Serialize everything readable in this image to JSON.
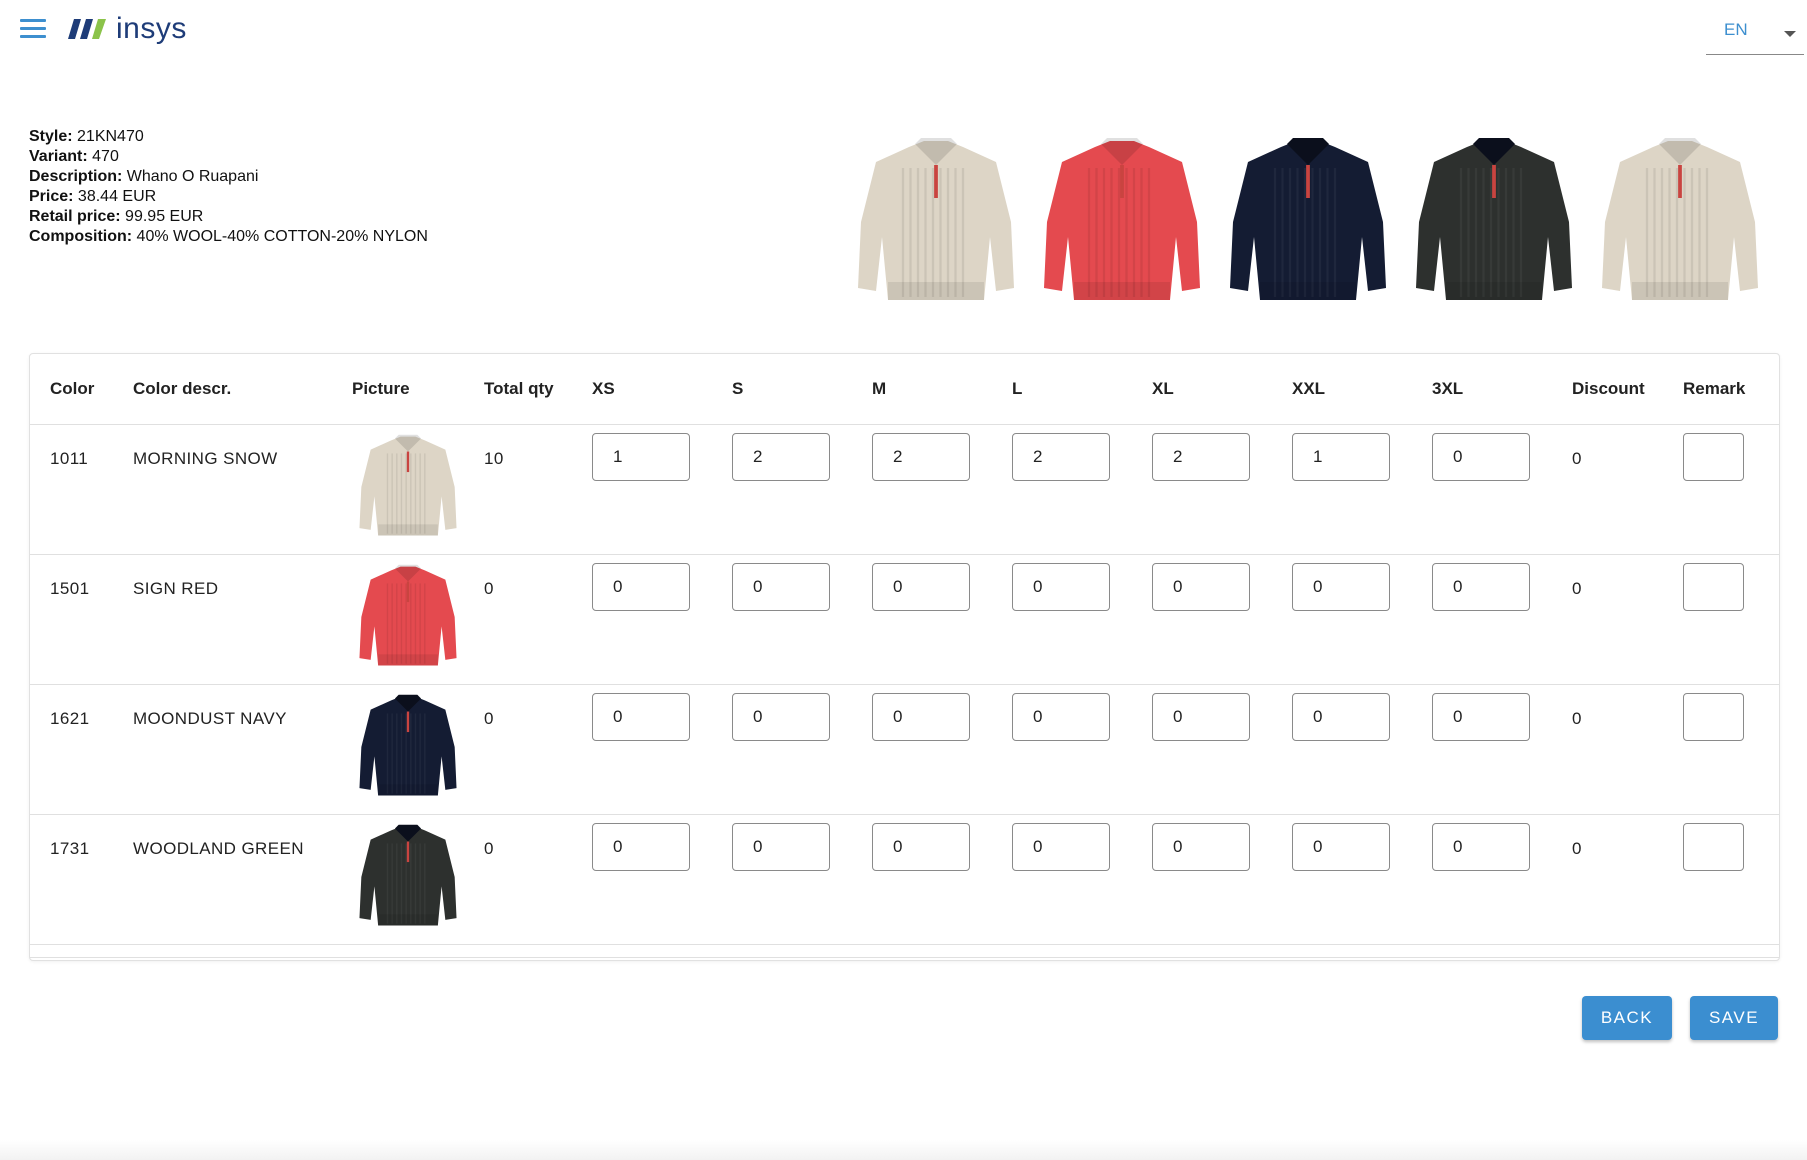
{
  "header": {
    "menu_icon": "hamburger-icon",
    "logo_text": "insys",
    "language": "EN",
    "colors": {
      "accent": "#3d8fcf",
      "logo_blue": "#1e3c78",
      "logo_green": "#8bc34a"
    }
  },
  "product": {
    "style_label": "Style:",
    "style_value": "21KN470",
    "variant_label": "Variant:",
    "variant_value": "470",
    "description_label": "Description:",
    "description_value": "Whano O Ruapani",
    "price_label": "Price:",
    "price_value": "38.44 EUR",
    "retail_label": "Retail price:",
    "retail_value": "99.95 EUR",
    "composition_label": "Composition:",
    "composition_value": "40% WOOL-40% COTTON-20% NYLON"
  },
  "gallery": [
    {
      "color": "#ddd5c6"
    },
    {
      "color": "#e44a4f"
    },
    {
      "color": "#141c33"
    },
    {
      "color": "#2d302e"
    },
    {
      "color": "#ddd5c6"
    }
  ],
  "table": {
    "headers": [
      "Color",
      "Color descr.",
      "Picture",
      "Total qty",
      "XS",
      "S",
      "M",
      "L",
      "XL",
      "XXL",
      "3XL",
      "Discount",
      "Remark"
    ],
    "rows": [
      {
        "color": "1011",
        "descr": "MORNING SNOW",
        "swatch": "#ddd5c6",
        "total": "10",
        "sizes": [
          "1",
          "2",
          "2",
          "2",
          "2",
          "1",
          "0"
        ],
        "discount": "0",
        "remark": ""
      },
      {
        "color": "1501",
        "descr": "SIGN RED",
        "swatch": "#e44a4f",
        "total": "0",
        "sizes": [
          "0",
          "0",
          "0",
          "0",
          "0",
          "0",
          "0"
        ],
        "discount": "0",
        "remark": ""
      },
      {
        "color": "1621",
        "descr": "MOONDUST NAVY",
        "swatch": "#141c33",
        "total": "0",
        "sizes": [
          "0",
          "0",
          "0",
          "0",
          "0",
          "0",
          "0"
        ],
        "discount": "0",
        "remark": ""
      },
      {
        "color": "1731",
        "descr": "WOODLAND GREEN",
        "swatch": "#2d302e",
        "total": "0",
        "sizes": [
          "0",
          "0",
          "0",
          "0",
          "0",
          "0",
          "0"
        ],
        "discount": "0",
        "remark": ""
      }
    ]
  },
  "actions": {
    "back_label": "BACK",
    "save_label": "SAVE",
    "button_color": "#3b8ed0"
  }
}
